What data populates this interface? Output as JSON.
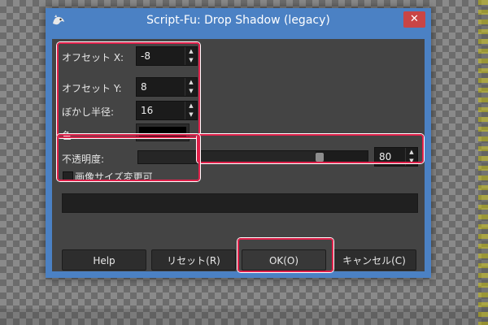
{
  "window": {
    "title": "Script-Fu: Drop Shadow (legacy)",
    "close_glyph": "✕",
    "app_icon": "gimp-wilber-icon"
  },
  "fields": {
    "offset_x": {
      "label": "オフセット X:",
      "value": "-8"
    },
    "offset_y": {
      "label": "オフセット Y:",
      "value": "8"
    },
    "blur_radius": {
      "label": "ぼかし半径:",
      "value": "16"
    },
    "color": {
      "label": "色:",
      "value": "#000000"
    },
    "opacity": {
      "label": "不透明度:",
      "value": "80",
      "fraction": 0.8
    },
    "resize_checkbox": {
      "label": "画像サイズ変更可",
      "checked": false
    }
  },
  "buttons": {
    "help": "Help",
    "reset": "リセット(R)",
    "ok": "OK(O)",
    "cancel": "キャンセル(C)"
  },
  "spin_glyphs": {
    "up": "▲",
    "down": "▼"
  },
  "colors": {
    "titlebar": "#4b81c4",
    "highlight": "#e0204a",
    "dialog_bg": "#444444"
  }
}
